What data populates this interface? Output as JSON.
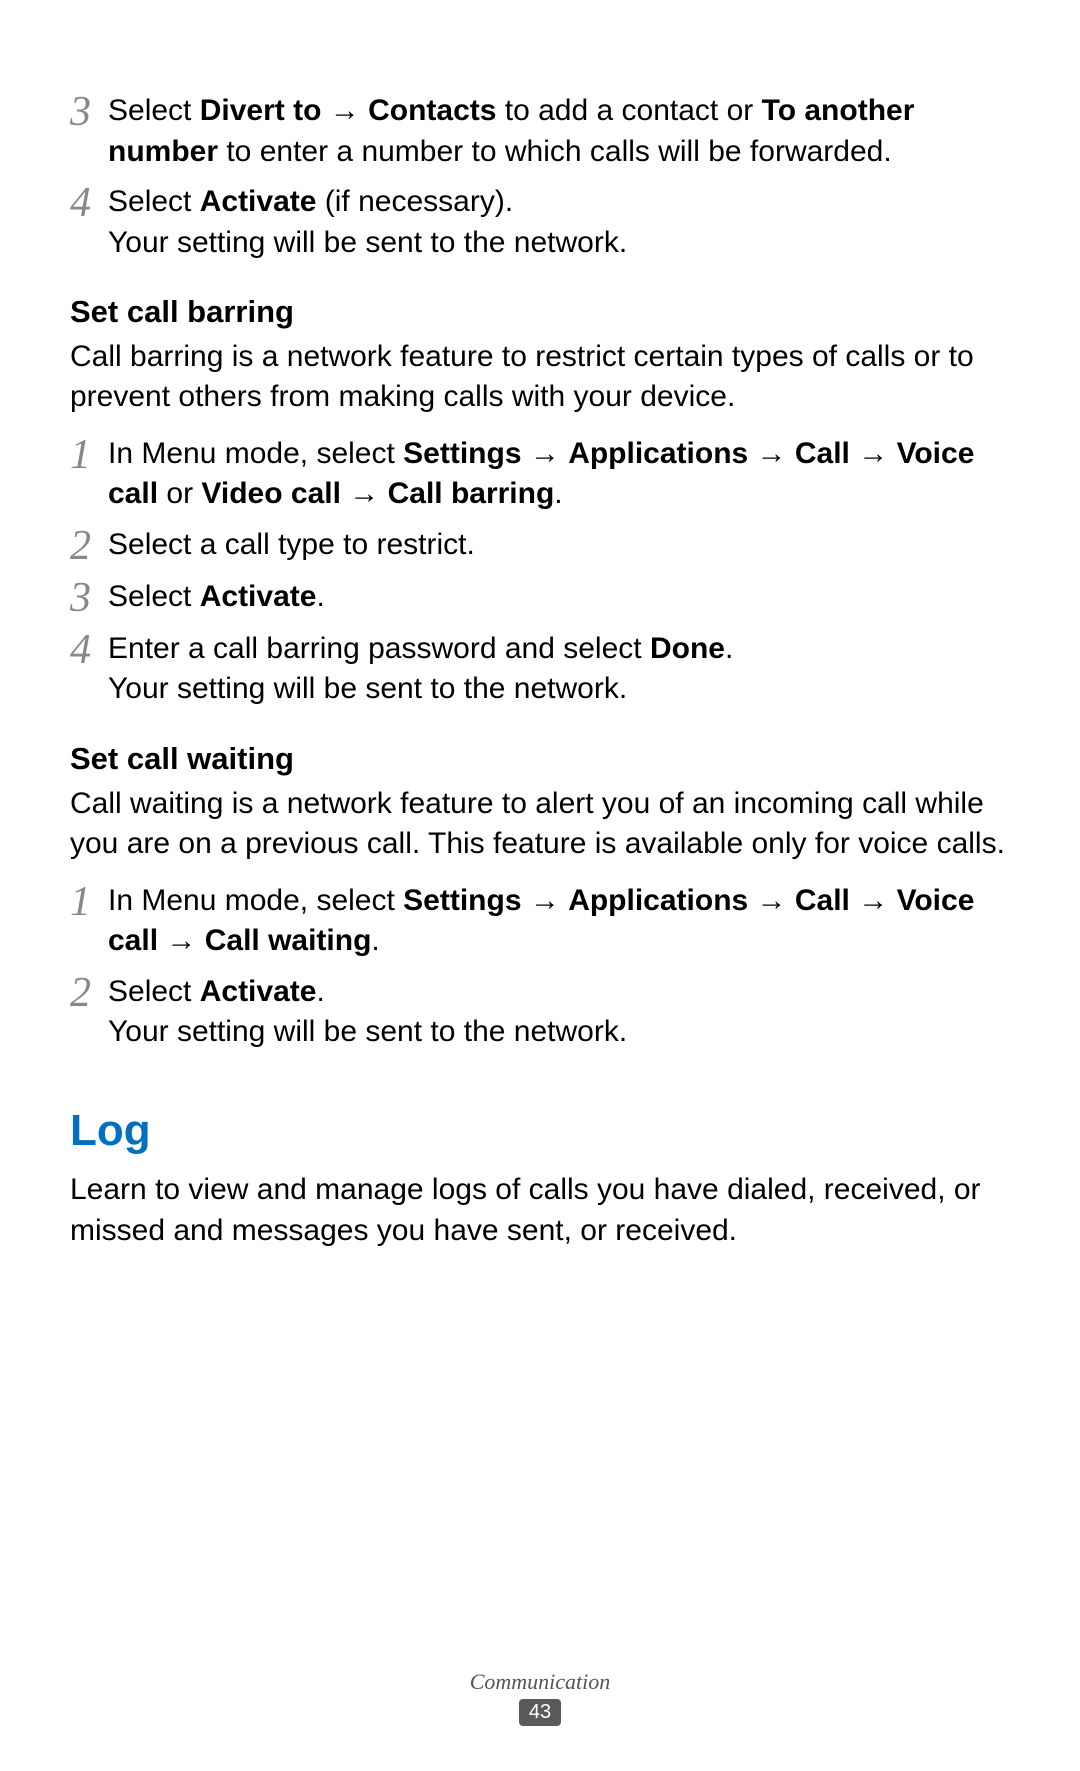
{
  "steps_top": [
    {
      "num": "3",
      "parts": [
        {
          "t": "Select ",
          "b": false
        },
        {
          "t": "Divert to",
          "b": true
        },
        {
          "t": " → ",
          "b": false
        },
        {
          "t": "Contacts",
          "b": true
        },
        {
          "t": " to add a contact or ",
          "b": false
        },
        {
          "t": "To another number",
          "b": true
        },
        {
          "t": " to enter a number to which calls will be forwarded.",
          "b": false
        }
      ]
    },
    {
      "num": "4",
      "parts": [
        {
          "t": "Select ",
          "b": false
        },
        {
          "t": "Activate",
          "b": true
        },
        {
          "t": " (if necessary).",
          "b": false
        }
      ],
      "extra": "Your setting will be sent to the network."
    }
  ],
  "barring": {
    "heading": "Set call barring",
    "desc": "Call barring is a network feature to restrict certain types of calls or to prevent others from making calls with your device.",
    "steps": [
      {
        "num": "1",
        "parts": [
          {
            "t": "In Menu mode, select ",
            "b": false
          },
          {
            "t": "Settings",
            "b": true
          },
          {
            "t": " → ",
            "b": false
          },
          {
            "t": "Applications",
            "b": true
          },
          {
            "t": " → ",
            "b": false
          },
          {
            "t": "Call",
            "b": true
          },
          {
            "t": " → ",
            "b": false
          },
          {
            "t": "Voice call",
            "b": true
          },
          {
            "t": " or ",
            "b": false
          },
          {
            "t": "Video call",
            "b": true
          },
          {
            "t": " → ",
            "b": false
          },
          {
            "t": "Call barring",
            "b": true
          },
          {
            "t": ".",
            "b": false
          }
        ]
      },
      {
        "num": "2",
        "parts": [
          {
            "t": "Select a call type to restrict.",
            "b": false
          }
        ]
      },
      {
        "num": "3",
        "parts": [
          {
            "t": "Select ",
            "b": false
          },
          {
            "t": "Activate",
            "b": true
          },
          {
            "t": ".",
            "b": false
          }
        ]
      },
      {
        "num": "4",
        "parts": [
          {
            "t": "Enter a call barring password and select ",
            "b": false
          },
          {
            "t": "Done",
            "b": true
          },
          {
            "t": ".",
            "b": false
          }
        ],
        "extra": "Your setting will be sent to the network."
      }
    ]
  },
  "waiting": {
    "heading": "Set call waiting",
    "desc": "Call waiting is a network feature to alert you of an incoming call while you are on a previous call. This feature is available only for voice calls.",
    "steps": [
      {
        "num": "1",
        "parts": [
          {
            "t": "In Menu mode, select ",
            "b": false
          },
          {
            "t": "Settings",
            "b": true
          },
          {
            "t": " → ",
            "b": false
          },
          {
            "t": "Applications",
            "b": true
          },
          {
            "t": " → ",
            "b": false
          },
          {
            "t": "Call",
            "b": true
          },
          {
            "t": " → ",
            "b": false
          },
          {
            "t": "Voice call",
            "b": true
          },
          {
            "t": " → ",
            "b": false
          },
          {
            "t": "Call waiting",
            "b": true
          },
          {
            "t": ".",
            "b": false
          }
        ]
      },
      {
        "num": "2",
        "parts": [
          {
            "t": "Select ",
            "b": false
          },
          {
            "t": "Activate",
            "b": true
          },
          {
            "t": ".",
            "b": false
          }
        ],
        "extra": "Your setting will be sent to the network."
      }
    ]
  },
  "log": {
    "heading": "Log",
    "desc": "Learn to view and manage logs of calls you have dialed, received, or missed and messages you have sent, or received."
  },
  "footer": {
    "section": "Communication",
    "page": "43"
  }
}
